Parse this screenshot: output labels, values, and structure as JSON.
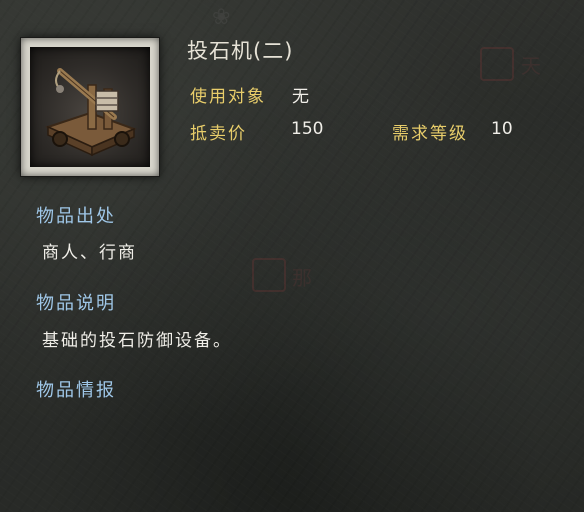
{
  "item": {
    "name": "投石机(二)",
    "icon": "catapult-icon"
  },
  "stats": {
    "target_label": "使用对象",
    "target_value": "无",
    "price_label": "抵卖价",
    "price_value": "150",
    "level_label": "需求等级",
    "level_value": "10"
  },
  "sections": {
    "source_heading": "物品出处",
    "source_text": "商人、行商",
    "description_heading": "物品说明",
    "description_text": "基础的投石防御设备。",
    "intel_heading": "物品情报"
  },
  "colors": {
    "gold_label": "#e8cd6a",
    "section_heading": "#9fc7e8",
    "text": "#f0eee8"
  }
}
